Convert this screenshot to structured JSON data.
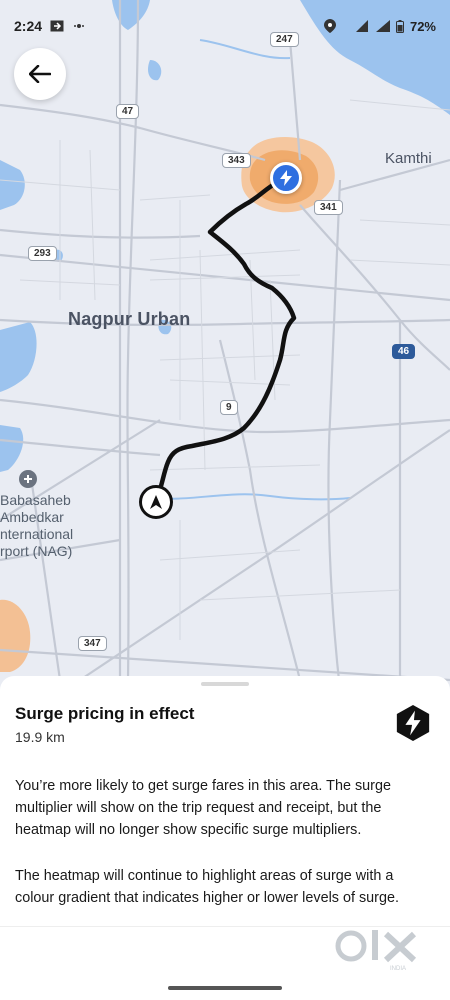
{
  "status_bar": {
    "time": "2:24",
    "battery": "72%"
  },
  "map": {
    "city_label": "Nagpur Urban",
    "kamthi_label": "Kamthi",
    "airport_lines": [
      "Babasaheb",
      "Ambedkar",
      "nternational",
      "rport (NAG)"
    ],
    "road_shields": [
      "247",
      "47",
      "343",
      "341",
      "293",
      "46",
      "9",
      "347"
    ]
  },
  "sheet": {
    "title": "Surge pricing in effect",
    "distance": "19.9 km",
    "paragraph_1": "You’re more likely to get surge fares in this area. The surge multiplier will show on the trip request and receipt, but the heatmap will no longer show specific surge multipliers.",
    "paragraph_2": "The heatmap will continue to highlight areas of surge with a colour gradient that indicates higher or lower levels of surge.",
    "watermark_text": "OLX",
    "watermark_subtext": "INDIA"
  },
  "icons": {
    "back": "arrow-left-icon",
    "pin": "bolt-icon",
    "origin": "navigation-arrow-icon",
    "surge": "surge-bolt-icon"
  },
  "colors": {
    "route": "#111111",
    "pin_blue": "#2f6fe0",
    "surge_heat": "#f2b07a",
    "water": "#9cc3ee"
  }
}
